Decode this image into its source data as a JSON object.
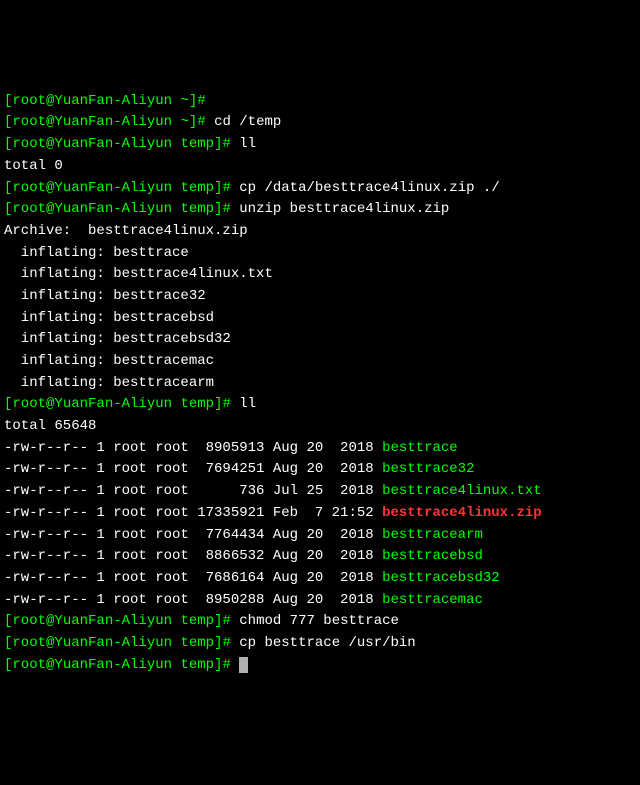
{
  "p": {
    "open": "[",
    "close": "]",
    "userhost": "root@YuanFan-Aliyun",
    "loc_home": " ~",
    "loc_temp": " temp",
    "hash": "#"
  },
  "cmds": {
    "blank": "",
    "cd": " cd /temp",
    "ll1": " ll",
    "cp1": " cp /data/besttrace4linux.zip ./",
    "unzip": " unzip besttrace4linux.zip",
    "ll2": " ll",
    "chmod": " chmod 777 besttrace",
    "cp2": " cp besttrace /usr/bin",
    "last": " "
  },
  "out": {
    "total0": "total 0",
    "archive": "Archive:  besttrace4linux.zip",
    "inflate": [
      "  inflating: besttrace",
      "  inflating: besttrace4linux.txt",
      "  inflating: besttrace32",
      "  inflating: besttracebsd",
      "  inflating: besttracebsd32",
      "  inflating: besttracemac",
      "  inflating: besttracearm"
    ],
    "total2": "total 65648",
    "ls": [
      {
        "meta": "-rw-r--r-- 1 root root  8905913 Aug 20  2018 ",
        "name": "besttrace",
        "cls": "green"
      },
      {
        "meta": "-rw-r--r-- 1 root root  7694251 Aug 20  2018 ",
        "name": "besttrace32",
        "cls": "green"
      },
      {
        "meta": "-rw-r--r-- 1 root root      736 Jul 25  2018 ",
        "name": "besttrace4linux.txt",
        "cls": "green"
      },
      {
        "meta": "-rw-r--r-- 1 root root 17335921 Feb  7 21:52 ",
        "name": "besttrace4linux.zip",
        "cls": "zip"
      },
      {
        "meta": "-rw-r--r-- 1 root root  7764434 Aug 20  2018 ",
        "name": "besttracearm",
        "cls": "green"
      },
      {
        "meta": "-rw-r--r-- 1 root root  8866532 Aug 20  2018 ",
        "name": "besttracebsd",
        "cls": "green"
      },
      {
        "meta": "-rw-r--r-- 1 root root  7686164 Aug 20  2018 ",
        "name": "besttracebsd32",
        "cls": "green"
      },
      {
        "meta": "-rw-r--r-- 1 root root  8950288 Aug 20  2018 ",
        "name": "besttracemac",
        "cls": "green"
      }
    ]
  }
}
